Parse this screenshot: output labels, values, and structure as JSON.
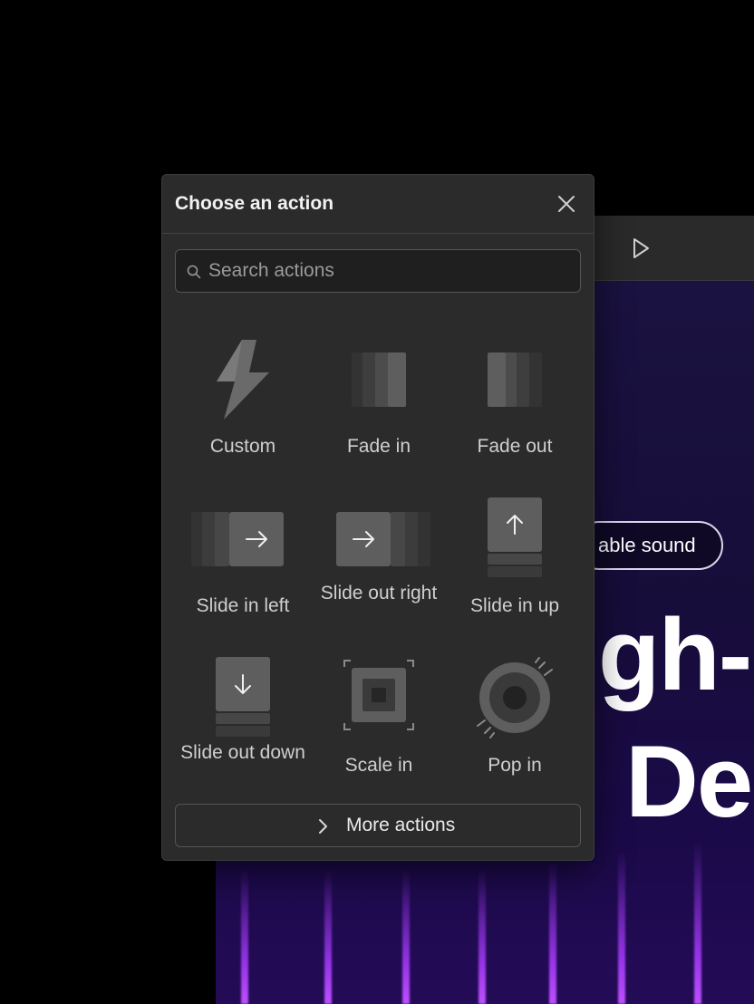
{
  "dialog": {
    "title": "Choose an action",
    "search_placeholder": "Search actions",
    "actions": [
      {
        "label": "Custom",
        "icon": "lightning-bolt-icon"
      },
      {
        "label": "Fade in",
        "icon": "fade-in-icon"
      },
      {
        "label": "Fade out",
        "icon": "fade-out-icon"
      },
      {
        "label": "Slide in left",
        "icon": "slide-in-left-icon"
      },
      {
        "label": "Slide out right",
        "icon": "slide-out-right-icon"
      },
      {
        "label": "Slide in up",
        "icon": "slide-in-up-icon"
      },
      {
        "label": "Slide out down",
        "icon": "slide-out-down-icon"
      },
      {
        "label": "Scale in",
        "icon": "scale-in-icon"
      },
      {
        "label": "Pop in",
        "icon": "pop-in-icon"
      }
    ],
    "more_label": "More actions"
  },
  "canvas": {
    "sound_pill": "able sound",
    "hero_line_1": "gh-",
    "hero_line_2": "De"
  },
  "colors": {
    "dialog_bg": "#2b2b2b",
    "stage_accent": "#a23cff"
  }
}
